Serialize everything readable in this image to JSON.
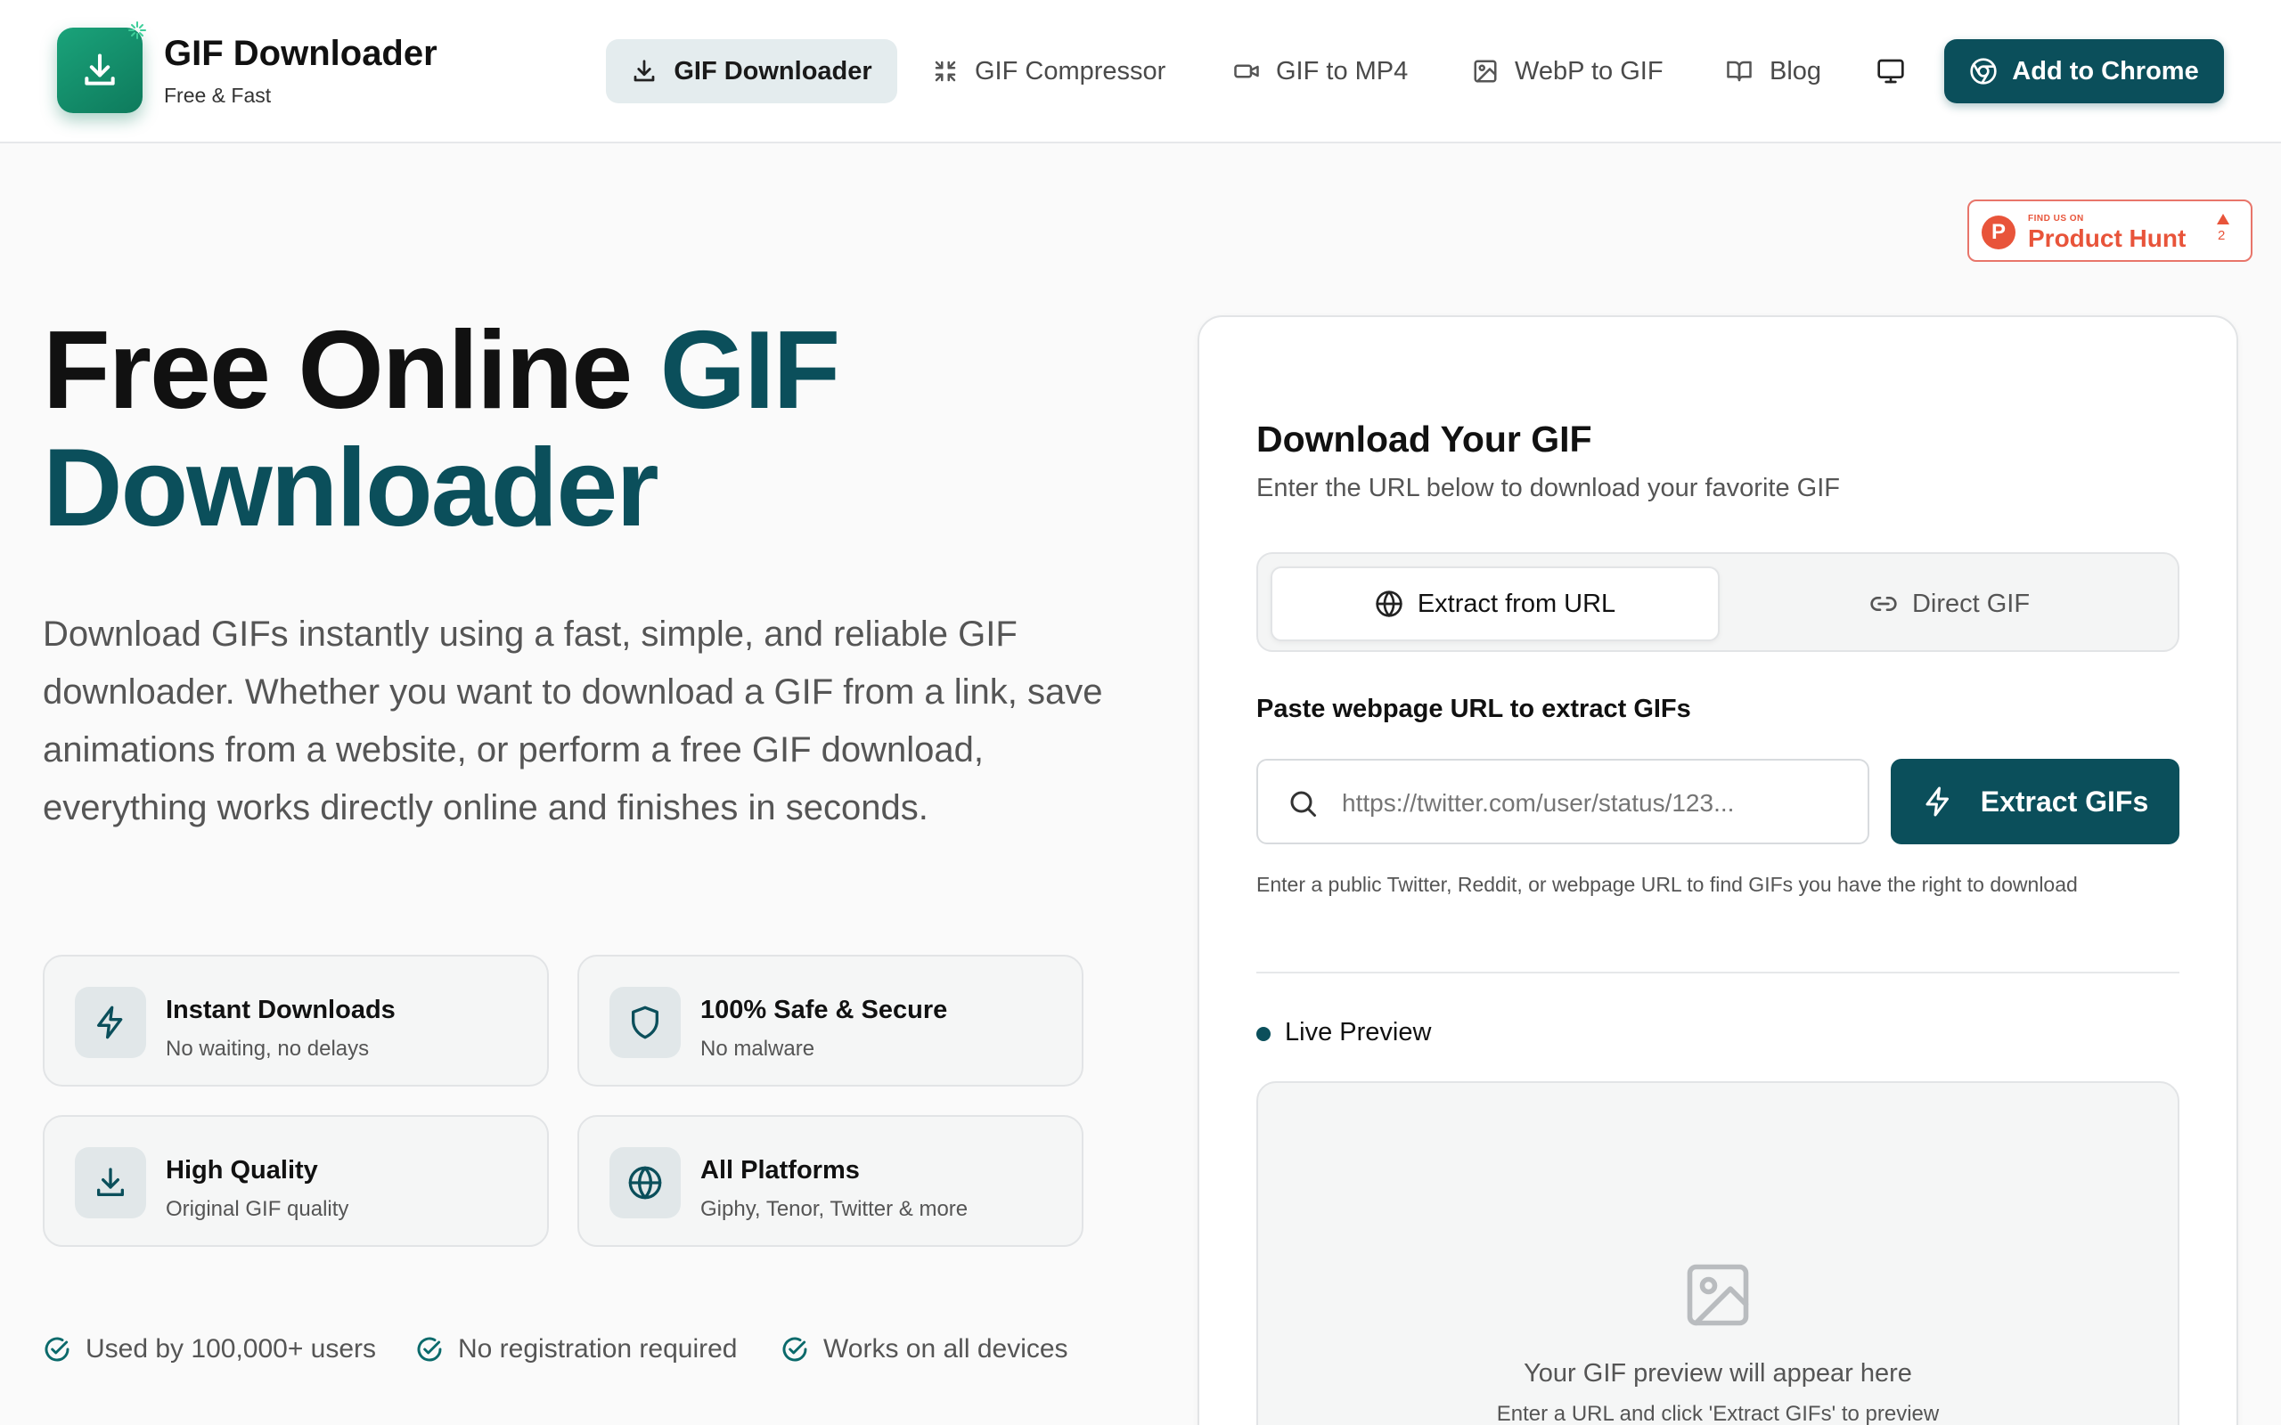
{
  "brand": {
    "name": "GIF Downloader",
    "tagline": "Free & Fast"
  },
  "nav": {
    "items": [
      {
        "label": "GIF Downloader",
        "icon": "download-icon",
        "active": true
      },
      {
        "label": "GIF Compressor",
        "icon": "compress-icon"
      },
      {
        "label": "GIF to MP4",
        "icon": "video-icon"
      },
      {
        "label": "WebP to GIF",
        "icon": "image-icon"
      },
      {
        "label": "Blog",
        "icon": "book-icon"
      }
    ],
    "theme_icon": "monitor-icon",
    "cta_label": "Add to Chrome"
  },
  "product_hunt": {
    "kicker": "FIND US ON",
    "name": "Product Hunt",
    "letter": "P",
    "upvotes": "2"
  },
  "hero": {
    "title_plain": "Free Online ",
    "title_accent_1": "GIF",
    "title_accent_2": "Downloader",
    "description": "Download GIFs instantly using a fast, simple, and reliable GIF downloader. Whether you want to download a GIF from a link, save animations from a website, or perform a free GIF download, everything works directly online and finishes in seconds."
  },
  "features": [
    {
      "title": "Instant Downloads",
      "subtitle": "No waiting, no delays",
      "icon": "lightning-icon"
    },
    {
      "title": "100% Safe & Secure",
      "subtitle": "No malware",
      "icon": "shield-icon"
    },
    {
      "title": "High Quality",
      "subtitle": "Original GIF quality",
      "icon": "download-icon"
    },
    {
      "title": "All Platforms",
      "subtitle": "Giphy, Tenor, Twitter & more",
      "icon": "globe-icon"
    }
  ],
  "trust": [
    "Used by 100,000+ users",
    "No registration required",
    "Works on all devices"
  ],
  "panel": {
    "title": "Download Your GIF",
    "subtitle": "Enter the URL below to download your favorite GIF",
    "tabs": [
      {
        "label": "Extract from URL",
        "icon": "globe-icon",
        "active": true
      },
      {
        "label": "Direct GIF",
        "icon": "link-icon"
      }
    ],
    "field_label": "Paste webpage URL to extract GIFs",
    "url_placeholder": "https://twitter.com/user/status/123...",
    "extract_label": "Extract GIFs",
    "helper": "Enter a public Twitter, Reddit, or webpage URL to find GIFs you have the right to download",
    "live_preview_label": "Live Preview",
    "preview_text": "Your GIF preview will appear here",
    "preview_hint": "Enter a URL and click 'Extract GIFs' to preview"
  },
  "colors": {
    "accent": "#0b4f5b",
    "brand_green": "#14916c",
    "product_hunt": "#e8543a",
    "check": "#0b6a6b"
  }
}
